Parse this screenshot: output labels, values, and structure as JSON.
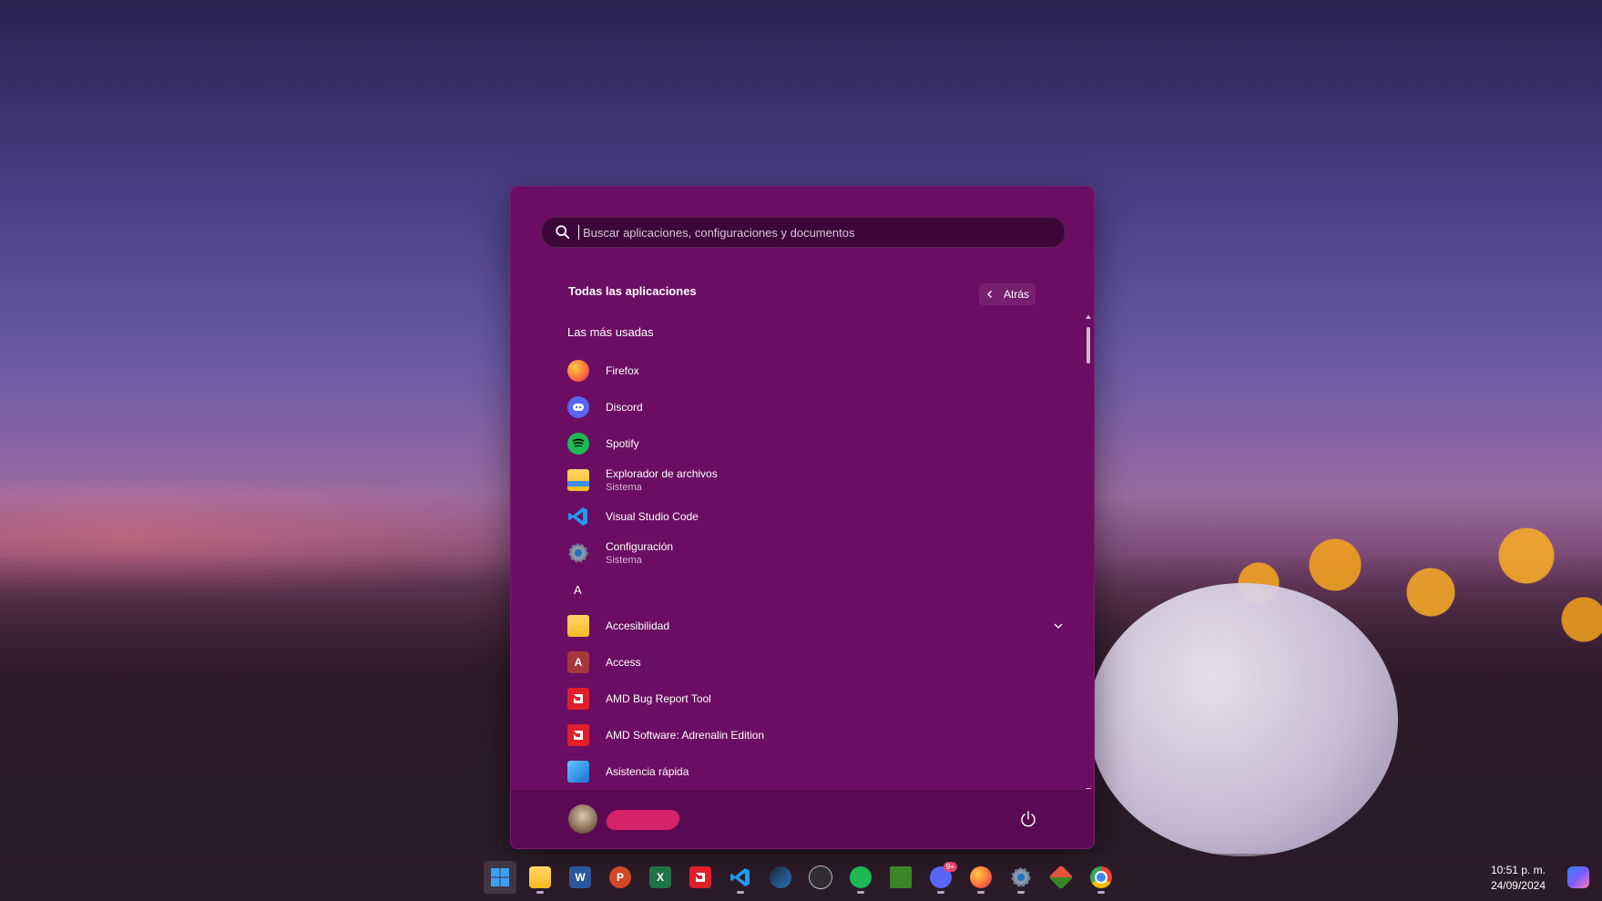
{
  "search": {
    "placeholder": "Buscar aplicaciones, configuraciones y documentos"
  },
  "header": {
    "title": "Todas las aplicaciones",
    "back_label": "Atrás"
  },
  "most_used": {
    "title": "Las más usadas",
    "items": [
      {
        "label": "Firefox",
        "sub": "",
        "icon": "firefox-icon",
        "color": "#ff7139"
      },
      {
        "label": "Discord",
        "sub": "",
        "icon": "discord-icon",
        "color": "#5865f2"
      },
      {
        "label": "Spotify",
        "sub": "",
        "icon": "spotify-icon",
        "color": "#1db954"
      },
      {
        "label": "Explorador de archivos",
        "sub": "Sistema",
        "icon": "folder-icon",
        "color": "#f5c242"
      },
      {
        "label": "Visual Studio Code",
        "sub": "",
        "icon": "vscode-icon",
        "color": "#0e7ad3"
      },
      {
        "label": "Configuración",
        "sub": "Sistema",
        "icon": "settings-gear-icon",
        "color": "#7c8fa5"
      }
    ]
  },
  "letter_a": {
    "header": "A",
    "items": [
      {
        "label": "Accesibilidad",
        "icon": "folder-icon",
        "color": "#f5c242"
      },
      {
        "label": "Access",
        "icon": "access-icon",
        "color": "#a4373a",
        "glyph": "A"
      },
      {
        "label": "AMD Bug Report Tool",
        "icon": "amd-icon",
        "color": "#e01f2a"
      },
      {
        "label": "AMD Software: Adrenalin Edition",
        "icon": "amd-icon",
        "color": "#e01f2a"
      },
      {
        "label": "Asistencia rápida",
        "icon": "quick-assist-icon",
        "color": "#1c8fe0"
      }
    ]
  },
  "taskbar": {
    "apps": [
      {
        "name": "start-icon",
        "color": "#3aa0f3",
        "active": true
      },
      {
        "name": "file-explorer-icon",
        "color": "#f5c242"
      },
      {
        "name": "word-icon",
        "color": "#2b579a",
        "glyph": "W"
      },
      {
        "name": "powerpoint-icon",
        "color": "#d24726",
        "glyph": "P"
      },
      {
        "name": "excel-icon",
        "color": "#217346",
        "glyph": "X"
      },
      {
        "name": "amd-icon",
        "color": "#e01f2a"
      },
      {
        "name": "vscode-icon",
        "color": "#0e7ad3"
      },
      {
        "name": "steam-icon",
        "color": "#1b2838"
      },
      {
        "name": "obs-icon",
        "color": "#302e31"
      },
      {
        "name": "spotify-icon",
        "color": "#1db954"
      },
      {
        "name": "minecraft-icon",
        "color": "#3c8527"
      },
      {
        "name": "discord-icon",
        "color": "#5865f2",
        "badge": "9+"
      },
      {
        "name": "firefox-icon",
        "color": "#ff7139"
      },
      {
        "name": "settings-gear-icon",
        "color": "#7c8fa5"
      },
      {
        "name": "git-icon",
        "color": "#e5533d"
      },
      {
        "name": "chrome-icon",
        "color": "#4285f4"
      }
    ],
    "time": "10:51 p. m.",
    "date": "24/09/2024"
  }
}
